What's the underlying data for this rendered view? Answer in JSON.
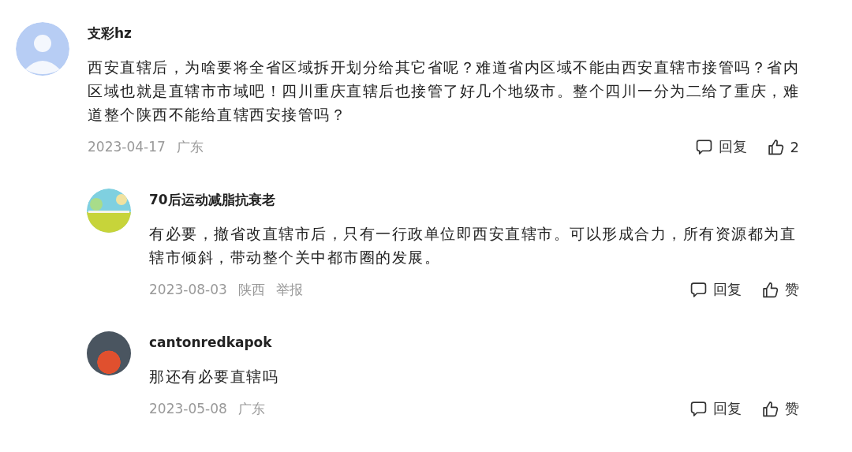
{
  "comments": [
    {
      "kind": "top",
      "avatar": {
        "kind": "default"
      },
      "user": "支彩hz",
      "text": "西安直辖后，为啥要将全省区域拆开划分给其它省呢？难道省内区域不能由西安直辖市接管吗？省内区域也就是直辖市市域吧！四川重庆直辖后也接管了好几个地级市。整个四川一分为二给了重庆，难道整个陕西不能给直辖西安接管吗？",
      "date": "2023-04-17",
      "location": "广东",
      "reply": "回复",
      "like": "2"
    },
    {
      "kind": "reply",
      "avatar": {
        "kind": "landscape"
      },
      "user": "70后运动减脂抗衰老",
      "text": "有必要，撤省改直辖市后，只有一行政单位即西安直辖市。可以形成合力，所有资源都为直辖市倾斜，带动整个关中都市圈的发展。",
      "date": "2023-08-03",
      "location": "陕西",
      "report": "举报",
      "reply": "回复",
      "like": "赞"
    },
    {
      "kind": "reply",
      "avatar": {
        "kind": "photo"
      },
      "user": "cantonredkapok",
      "text": "那还有必要直辖吗",
      "date": "2023-05-08",
      "location": "广东",
      "reply": "回复",
      "like": "赞"
    }
  ]
}
